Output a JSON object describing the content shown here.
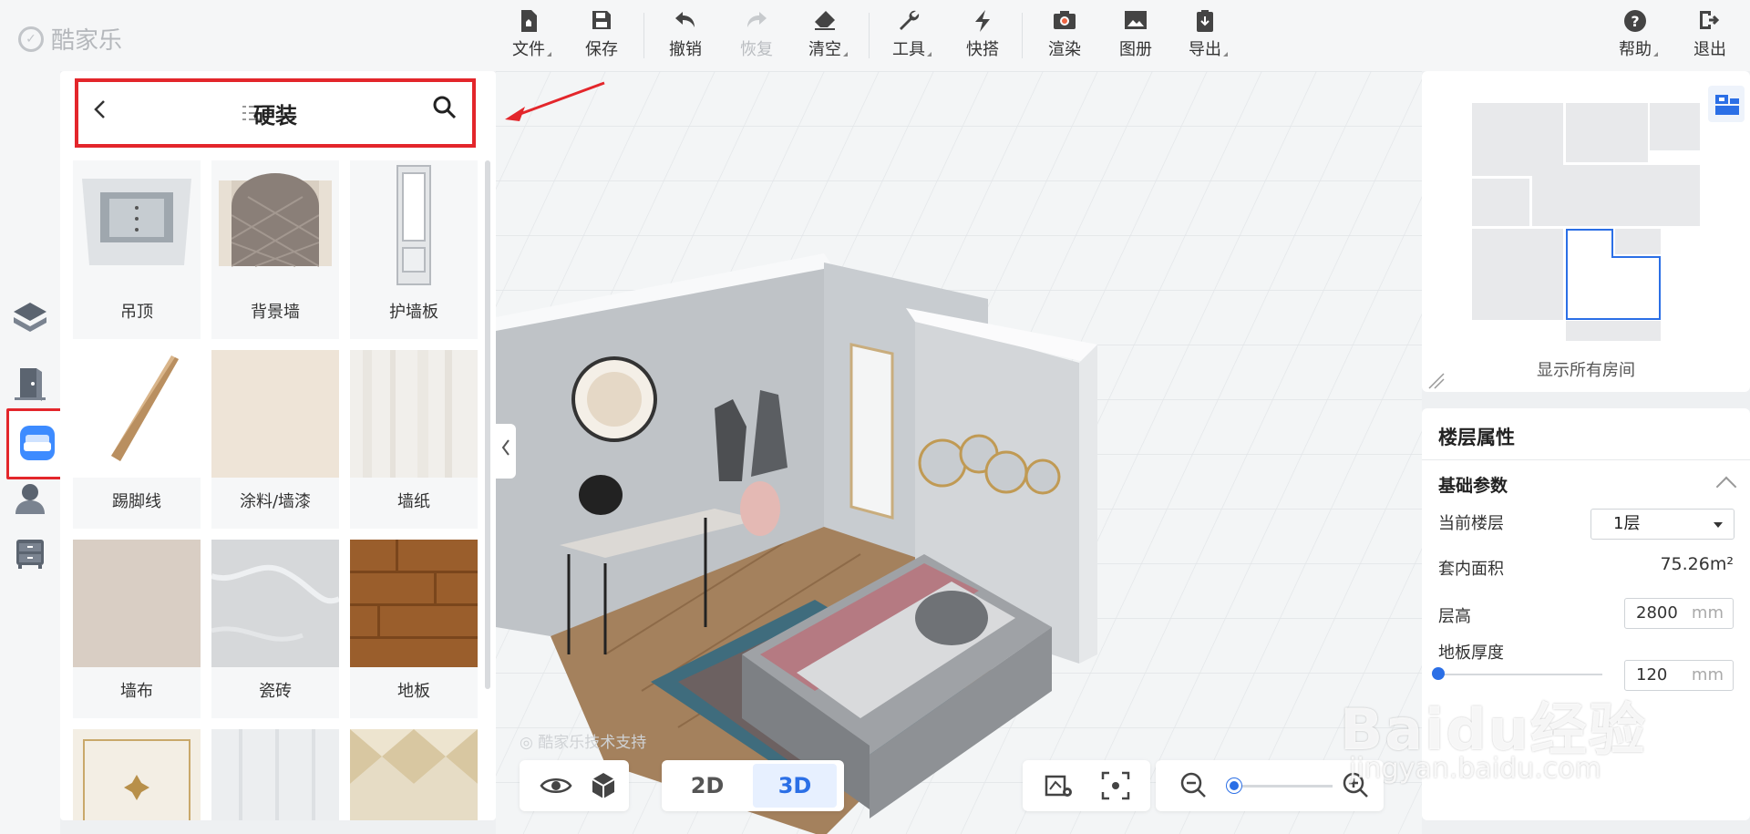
{
  "app": {
    "logo_text": "酷家乐"
  },
  "toolbar": {
    "file": "文件",
    "save": "保存",
    "undo": "撤销",
    "redo": "恢复",
    "clear": "清空",
    "tools": "工具",
    "quick": "快搭",
    "render": "渲染",
    "album": "图册",
    "export": "导出",
    "help": "帮助",
    "exit": "退出"
  },
  "panel": {
    "title": "硬装",
    "items": [
      {
        "label": "吊顶"
      },
      {
        "label": "背景墙"
      },
      {
        "label": "护墙板"
      },
      {
        "label": "踢脚线"
      },
      {
        "label": "涂料/墙漆"
      },
      {
        "label": "墙纸"
      },
      {
        "label": "墙布"
      },
      {
        "label": "瓷砖"
      },
      {
        "label": "地板"
      }
    ]
  },
  "viewport": {
    "support_text": "酷家乐技术支持",
    "mode_2d": "2D",
    "mode_3d": "3D",
    "active_mode": "3D"
  },
  "minimap": {
    "caption": "显示所有房间"
  },
  "floor_props": {
    "title": "楼层属性",
    "section": "基础参数",
    "current_floor_label": "当前楼层",
    "current_floor_value": "1层",
    "area_label": "套内面积",
    "area_value": "75.26m²",
    "height_label": "层高",
    "height_value": "2800",
    "height_unit": "mm",
    "thickness_label": "地板厚度",
    "thickness_value": "120",
    "thickness_unit": "mm"
  },
  "watermark": {
    "brand": "Baidu经验",
    "url": "jingyan.baidu.com"
  },
  "colors": {
    "accent": "#2b6fe6",
    "highlight_red": "#e3262b"
  }
}
